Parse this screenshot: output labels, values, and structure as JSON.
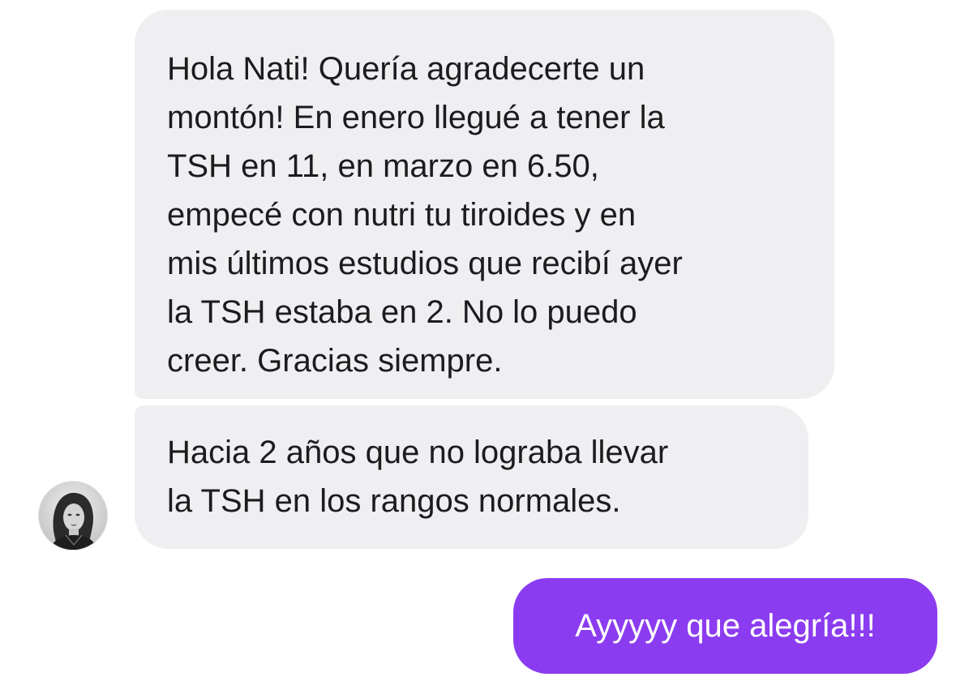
{
  "conversation": {
    "incoming": [
      {
        "lines": [
          "Hola Nati! Quería agradecerte un",
          "montón! En enero llegué a tener la",
          "TSH en 11, en marzo en 6.50,",
          "empecé con nutri tu tiroides y en",
          "mis últimos estudios que recibí ayer",
          "la TSH estaba en 2. No lo puedo",
          "creer. Gracias siempre."
        ]
      },
      {
        "lines": [
          "Hacia 2 años que no lograba llevar",
          "la TSH en los rangos normales."
        ]
      }
    ],
    "outgoing": [
      {
        "text": "Ayyyyy que alegría!!!"
      }
    ],
    "sender_avatar": {
      "icon": "profile-photo-avatar"
    }
  },
  "colors": {
    "incoming_bubble": "#efeff1",
    "incoming_text": "#1c1c1e",
    "outgoing_bubble": "#8b3cf0",
    "outgoing_text": "#ffffff"
  }
}
